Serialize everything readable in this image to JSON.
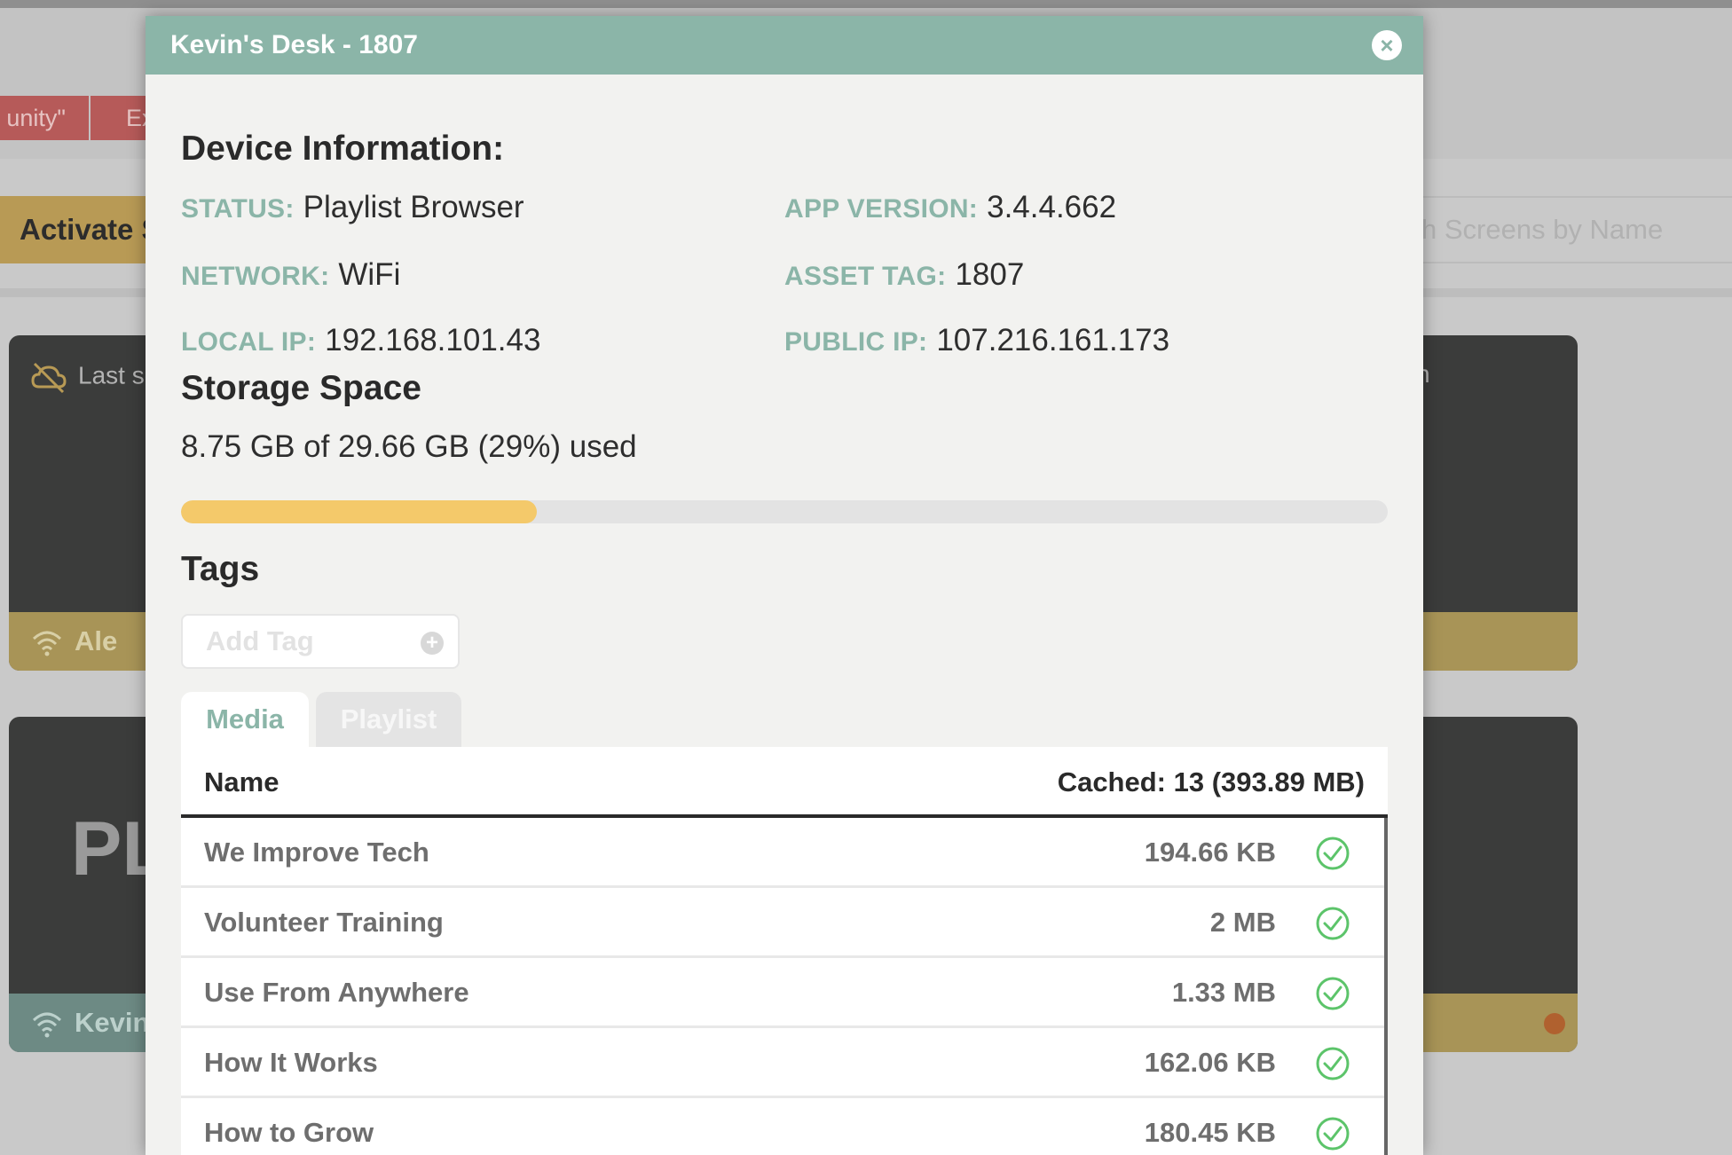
{
  "background": {
    "tabs": [
      "unity\"",
      "Ex"
    ],
    "activate_button": "Activate S",
    "search_placeholder": "h Screens by Name",
    "cards": [
      {
        "last_seen": "Last se",
        "right_text": "n",
        "footer": "Ale"
      },
      {
        "big_text": "PL",
        "footer": "Kevin"
      }
    ]
  },
  "modal": {
    "title": "Kevin's Desk - 1807",
    "close_label": "×",
    "device_info": {
      "heading": "Device Information:",
      "status_label": "STATUS:",
      "status_value": "Playlist Browser",
      "app_version_label": "APP VERSION:",
      "app_version_value": "3.4.4.662",
      "network_label": "NETWORK:",
      "network_value": "WiFi",
      "asset_tag_label": "ASSET TAG:",
      "asset_tag_value": "1807",
      "local_ip_label": "LOCAL IP:",
      "local_ip_value": "192.168.101.43",
      "public_ip_label": "PUBLIC IP:",
      "public_ip_value": "107.216.161.173"
    },
    "storage": {
      "heading": "Storage Space",
      "text": "8.75 GB of 29.66 GB (29%) used",
      "used_fraction": 0.295
    },
    "tags": {
      "heading": "Tags",
      "placeholder": "Add Tag"
    },
    "tabs": {
      "media": "Media",
      "playlist": "Playlist"
    },
    "table": {
      "col_name": "Name",
      "col_cached": "Cached: 13 (393.89 MB)",
      "rows": [
        {
          "name": "We Improve Tech",
          "size": "194.66 KB"
        },
        {
          "name": "Volunteer Training",
          "size": "2 MB"
        },
        {
          "name": "Use From Anywhere",
          "size": "1.33 MB"
        },
        {
          "name": "How It Works",
          "size": "162.06 KB"
        },
        {
          "name": "How to Grow",
          "size": "180.45 KB"
        }
      ]
    }
  },
  "colors": {
    "accent": "#8bb5a8",
    "progress": "#f4c96a",
    "check": "#5cc46a"
  }
}
